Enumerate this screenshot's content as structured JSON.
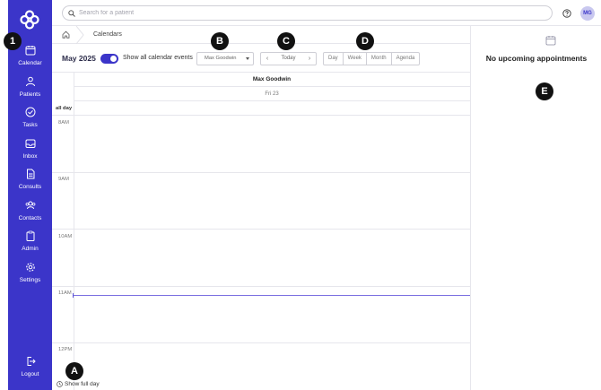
{
  "sidebar": {
    "items": [
      {
        "label": "Calendar",
        "icon": "calendar-icon"
      },
      {
        "label": "Patients",
        "icon": "user-icon"
      },
      {
        "label": "Tasks",
        "icon": "check-circle-icon"
      },
      {
        "label": "Inbox",
        "icon": "inbox-icon"
      },
      {
        "label": "Consults",
        "icon": "document-icon"
      },
      {
        "label": "Contacts",
        "icon": "contacts-icon"
      },
      {
        "label": "Admin",
        "icon": "clipboard-icon"
      },
      {
        "label": "Settings",
        "icon": "gear-icon"
      }
    ],
    "logout": "Logout"
  },
  "header": {
    "search_placeholder": "Search for a patient",
    "avatar_initials": "MG"
  },
  "breadcrumb": {
    "label": "Calendars"
  },
  "toolbar": {
    "month": "May 2025",
    "toggle_label": "Show all calendar events",
    "practitioner": "Max Goodwin",
    "prev": "‹",
    "today": "Today",
    "next": "›",
    "views": [
      "Day",
      "Week",
      "Month",
      "Agenda"
    ]
  },
  "calendar": {
    "column_name": "Max Goodwin",
    "column_date": "Fri 23",
    "all_day_label": "all day",
    "hours": [
      "8AM",
      "9AM",
      "10AM",
      "11AM",
      "12PM"
    ],
    "show_full_day": "Show full day"
  },
  "right_panel": {
    "message": "No upcoming appointments"
  },
  "annotations": [
    "1",
    "A",
    "B",
    "C",
    "D",
    "E"
  ],
  "colors": {
    "sidebar": "#3b35c9",
    "accent": "#3b35c9",
    "now_line": "#7a6fe0"
  }
}
